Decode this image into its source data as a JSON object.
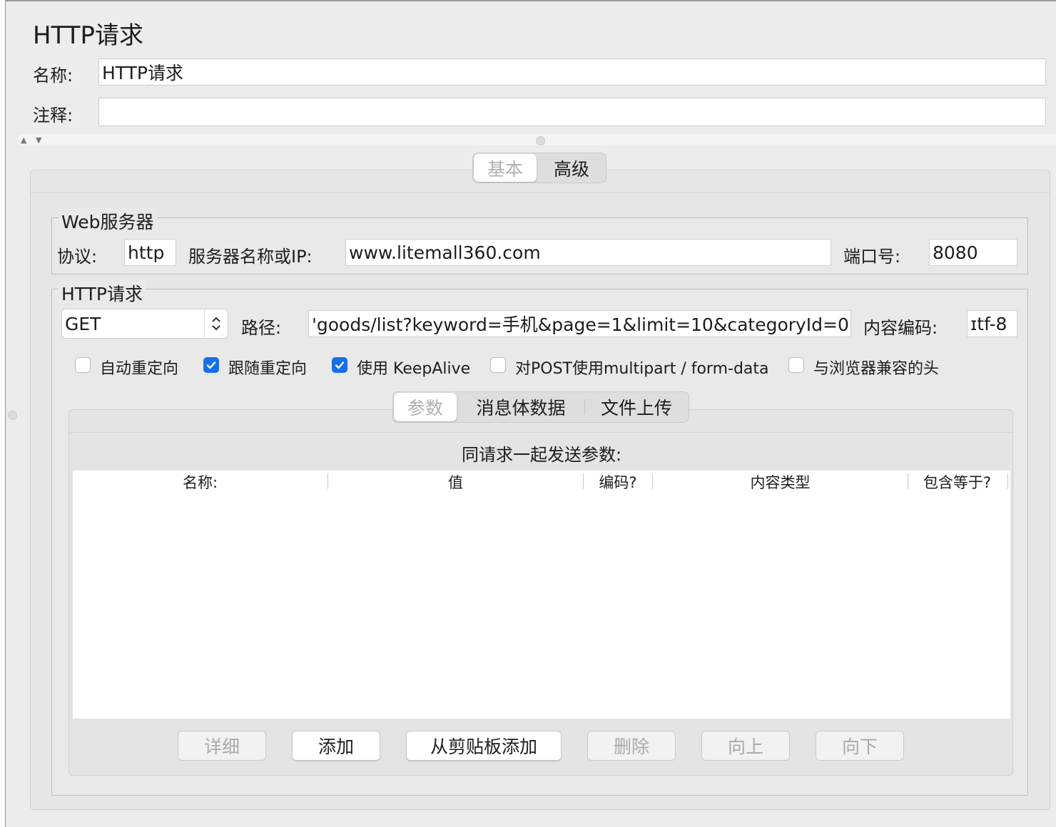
{
  "header": {
    "title": "HTTP请求",
    "name_label": "名称:",
    "name_value": "HTTP请求",
    "comment_label": "注释:",
    "comment_value": ""
  },
  "top_tabs": [
    {
      "label": "基本",
      "selected": true
    },
    {
      "label": "高级",
      "selected": false
    }
  ],
  "web_server": {
    "group_title": "Web服务器",
    "protocol_label": "协议:",
    "protocol_value": "http",
    "server_label": "服务器名称或IP:",
    "server_value": "www.litemall360.com",
    "port_label": "端口号:",
    "port_value": "8080"
  },
  "http_request": {
    "group_title": "HTTP请求",
    "method_value": "GET",
    "path_label": "路径:",
    "path_value": "'goods/list?keyword=手机&page=1&limit=10&categoryId=0",
    "encoding_label": "内容编码:",
    "encoding_value": "ɪtf-8"
  },
  "options": [
    {
      "label": "自动重定向",
      "checked": false
    },
    {
      "label": "跟随重定向",
      "checked": true
    },
    {
      "label": "使用 KeepAlive",
      "checked": true
    },
    {
      "label": "对POST使用multipart / form-data",
      "checked": false
    },
    {
      "label": "与浏览器兼容的头",
      "checked": false
    }
  ],
  "sub_tabs": [
    {
      "label": "参数",
      "selected": true
    },
    {
      "label": "消息体数据",
      "selected": false
    },
    {
      "label": "文件上传",
      "selected": false
    }
  ],
  "params": {
    "caption": "同请求一起发送参数:",
    "columns": [
      "名称:",
      "值",
      "编码?",
      "内容类型",
      "包含等于?"
    ],
    "rows": []
  },
  "buttons": [
    {
      "label": "详细",
      "enabled": false
    },
    {
      "label": "添加",
      "enabled": true
    },
    {
      "label": "从剪贴板添加",
      "enabled": true
    },
    {
      "label": "删除",
      "enabled": false
    },
    {
      "label": "向上",
      "enabled": false
    },
    {
      "label": "向下",
      "enabled": false
    }
  ],
  "colors": {
    "accent": "#1670e8",
    "background": "#ececec",
    "disabled_text": "#a9a9a9"
  }
}
